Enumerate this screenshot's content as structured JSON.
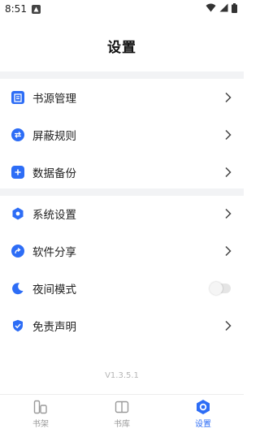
{
  "status_bar": {
    "time": "8:51"
  },
  "header": {
    "title": "设置"
  },
  "menu_group_1": [
    {
      "label": "书源管理",
      "icon": "book-source-icon"
    },
    {
      "label": "屏蔽规则",
      "icon": "swap-arrows-icon"
    },
    {
      "label": "数据备份",
      "icon": "plus-icon"
    }
  ],
  "menu_group_2": [
    {
      "label": "系统设置",
      "icon": "hexagon-settings-icon"
    },
    {
      "label": "软件分享",
      "icon": "share-arrow-icon"
    },
    {
      "label": "夜间模式",
      "icon": "moon-icon",
      "toggle": false
    },
    {
      "label": "免责声明",
      "icon": "shield-check-icon"
    }
  ],
  "version": "V1.3.5.1",
  "bottom_nav": [
    {
      "label": "书架",
      "active": false
    },
    {
      "label": "书库",
      "active": false
    },
    {
      "label": "设置",
      "active": true
    }
  ],
  "colors": {
    "accent": "#2d6df6",
    "divider": "#f2f3f5",
    "inactive": "#9a9a9a"
  }
}
